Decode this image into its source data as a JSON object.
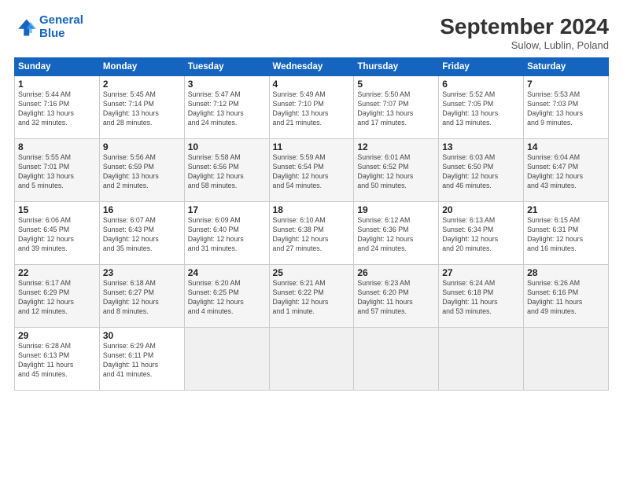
{
  "header": {
    "logo_line1": "General",
    "logo_line2": "Blue",
    "month_title": "September 2024",
    "subtitle": "Sulow, Lublin, Poland"
  },
  "weekdays": [
    "Sunday",
    "Monday",
    "Tuesday",
    "Wednesday",
    "Thursday",
    "Friday",
    "Saturday"
  ],
  "weeks": [
    [
      {
        "day": "1",
        "info": "Sunrise: 5:44 AM\nSunset: 7:16 PM\nDaylight: 13 hours\nand 32 minutes."
      },
      {
        "day": "2",
        "info": "Sunrise: 5:45 AM\nSunset: 7:14 PM\nDaylight: 13 hours\nand 28 minutes."
      },
      {
        "day": "3",
        "info": "Sunrise: 5:47 AM\nSunset: 7:12 PM\nDaylight: 13 hours\nand 24 minutes."
      },
      {
        "day": "4",
        "info": "Sunrise: 5:49 AM\nSunset: 7:10 PM\nDaylight: 13 hours\nand 21 minutes."
      },
      {
        "day": "5",
        "info": "Sunrise: 5:50 AM\nSunset: 7:07 PM\nDaylight: 13 hours\nand 17 minutes."
      },
      {
        "day": "6",
        "info": "Sunrise: 5:52 AM\nSunset: 7:05 PM\nDaylight: 13 hours\nand 13 minutes."
      },
      {
        "day": "7",
        "info": "Sunrise: 5:53 AM\nSunset: 7:03 PM\nDaylight: 13 hours\nand 9 minutes."
      }
    ],
    [
      {
        "day": "8",
        "info": "Sunrise: 5:55 AM\nSunset: 7:01 PM\nDaylight: 13 hours\nand 5 minutes."
      },
      {
        "day": "9",
        "info": "Sunrise: 5:56 AM\nSunset: 6:59 PM\nDaylight: 13 hours\nand 2 minutes."
      },
      {
        "day": "10",
        "info": "Sunrise: 5:58 AM\nSunset: 6:56 PM\nDaylight: 12 hours\nand 58 minutes."
      },
      {
        "day": "11",
        "info": "Sunrise: 5:59 AM\nSunset: 6:54 PM\nDaylight: 12 hours\nand 54 minutes."
      },
      {
        "day": "12",
        "info": "Sunrise: 6:01 AM\nSunset: 6:52 PM\nDaylight: 12 hours\nand 50 minutes."
      },
      {
        "day": "13",
        "info": "Sunrise: 6:03 AM\nSunset: 6:50 PM\nDaylight: 12 hours\nand 46 minutes."
      },
      {
        "day": "14",
        "info": "Sunrise: 6:04 AM\nSunset: 6:47 PM\nDaylight: 12 hours\nand 43 minutes."
      }
    ],
    [
      {
        "day": "15",
        "info": "Sunrise: 6:06 AM\nSunset: 6:45 PM\nDaylight: 12 hours\nand 39 minutes."
      },
      {
        "day": "16",
        "info": "Sunrise: 6:07 AM\nSunset: 6:43 PM\nDaylight: 12 hours\nand 35 minutes."
      },
      {
        "day": "17",
        "info": "Sunrise: 6:09 AM\nSunset: 6:40 PM\nDaylight: 12 hours\nand 31 minutes."
      },
      {
        "day": "18",
        "info": "Sunrise: 6:10 AM\nSunset: 6:38 PM\nDaylight: 12 hours\nand 27 minutes."
      },
      {
        "day": "19",
        "info": "Sunrise: 6:12 AM\nSunset: 6:36 PM\nDaylight: 12 hours\nand 24 minutes."
      },
      {
        "day": "20",
        "info": "Sunrise: 6:13 AM\nSunset: 6:34 PM\nDaylight: 12 hours\nand 20 minutes."
      },
      {
        "day": "21",
        "info": "Sunrise: 6:15 AM\nSunset: 6:31 PM\nDaylight: 12 hours\nand 16 minutes."
      }
    ],
    [
      {
        "day": "22",
        "info": "Sunrise: 6:17 AM\nSunset: 6:29 PM\nDaylight: 12 hours\nand 12 minutes."
      },
      {
        "day": "23",
        "info": "Sunrise: 6:18 AM\nSunset: 6:27 PM\nDaylight: 12 hours\nand 8 minutes."
      },
      {
        "day": "24",
        "info": "Sunrise: 6:20 AM\nSunset: 6:25 PM\nDaylight: 12 hours\nand 4 minutes."
      },
      {
        "day": "25",
        "info": "Sunrise: 6:21 AM\nSunset: 6:22 PM\nDaylight: 12 hours\nand 1 minute."
      },
      {
        "day": "26",
        "info": "Sunrise: 6:23 AM\nSunset: 6:20 PM\nDaylight: 11 hours\nand 57 minutes."
      },
      {
        "day": "27",
        "info": "Sunrise: 6:24 AM\nSunset: 6:18 PM\nDaylight: 11 hours\nand 53 minutes."
      },
      {
        "day": "28",
        "info": "Sunrise: 6:26 AM\nSunset: 6:16 PM\nDaylight: 11 hours\nand 49 minutes."
      }
    ],
    [
      {
        "day": "29",
        "info": "Sunrise: 6:28 AM\nSunset: 6:13 PM\nDaylight: 11 hours\nand 45 minutes."
      },
      {
        "day": "30",
        "info": "Sunrise: 6:29 AM\nSunset: 6:11 PM\nDaylight: 11 hours\nand 41 minutes."
      },
      {
        "day": "",
        "info": ""
      },
      {
        "day": "",
        "info": ""
      },
      {
        "day": "",
        "info": ""
      },
      {
        "day": "",
        "info": ""
      },
      {
        "day": "",
        "info": ""
      }
    ]
  ]
}
